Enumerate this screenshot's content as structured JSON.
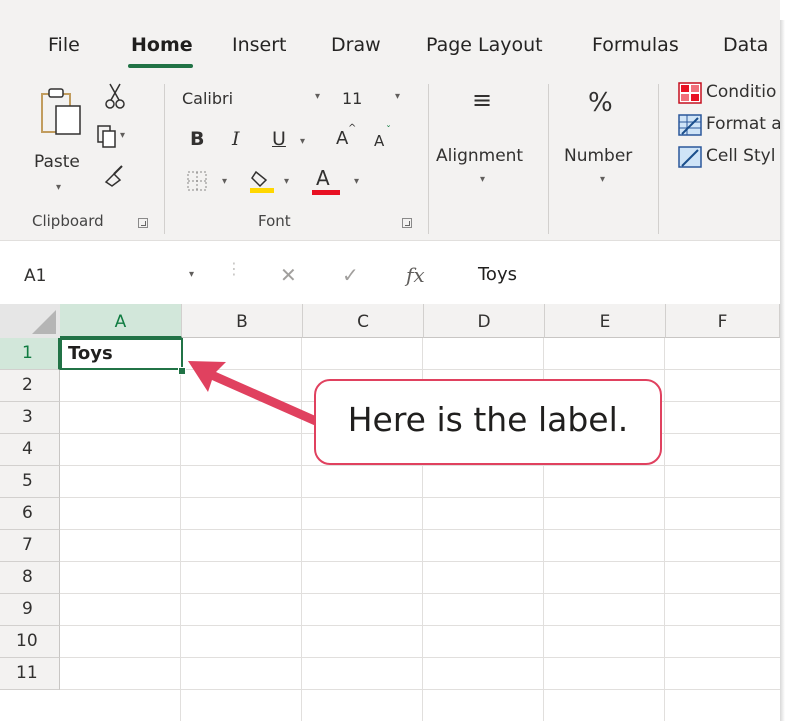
{
  "tabs": [
    "File",
    "Home",
    "Insert",
    "Draw",
    "Page Layout",
    "Formulas",
    "Data"
  ],
  "ribbon": {
    "clipboard": {
      "paste": "Paste",
      "label": "Clipboard",
      "icons": [
        "paste-icon",
        "cut-icon",
        "copy-icon",
        "format-painter-icon"
      ]
    },
    "font": {
      "family": "Calibri",
      "size": "11",
      "label": "Font",
      "bold": "B",
      "italic": "I",
      "underline": "U",
      "grow": "A",
      "shrink": "A",
      "font_color": "A",
      "fill_color_hex": "#ffd700",
      "font_color_hex": "#e81123"
    },
    "alignment": {
      "label": "Alignment",
      "icon": "≡"
    },
    "number": {
      "label": "Number",
      "icon": "%"
    },
    "styles": {
      "conditional": "Conditio",
      "format_table": "Format a",
      "cell_styles": "Cell Styl"
    }
  },
  "formula_bar": {
    "name_box": "A1",
    "fx": "fx",
    "value": "Toys"
  },
  "grid": {
    "columns": [
      "A",
      "B",
      "C",
      "D",
      "E",
      "F"
    ],
    "rows": [
      "1",
      "2",
      "3",
      "4",
      "5",
      "6",
      "7",
      "8",
      "9",
      "10",
      "11"
    ],
    "active_cell": {
      "ref": "A1",
      "value": "Toys"
    }
  },
  "callout": {
    "text": "Here is the label."
  },
  "colors": {
    "excel_green": "#217346",
    "callout_red": "#e0415f"
  }
}
